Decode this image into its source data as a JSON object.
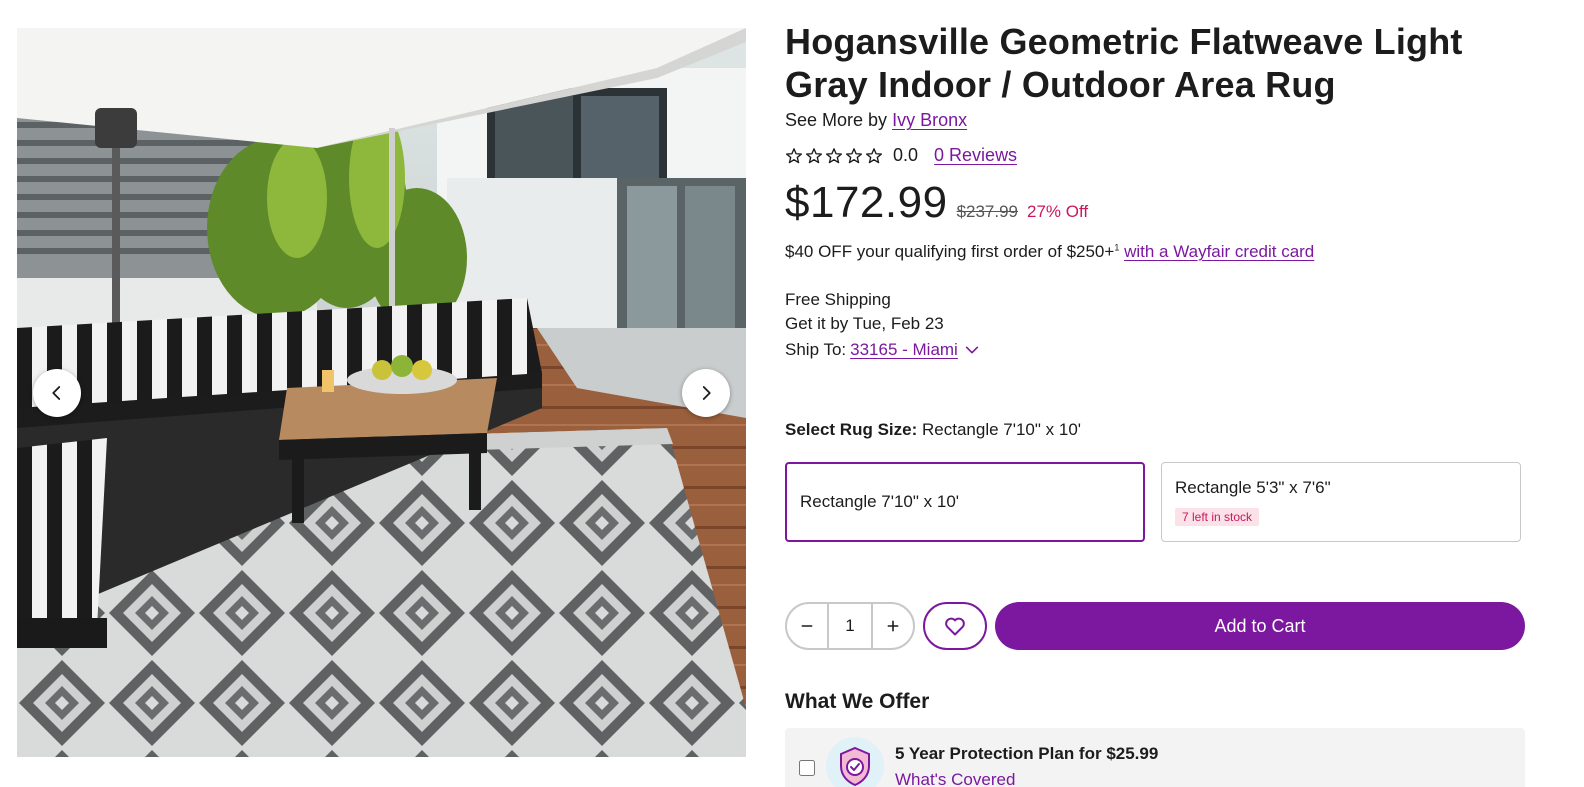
{
  "gallery": {
    "prev_label": "Previous image",
    "next_label": "Next image"
  },
  "product": {
    "title": "Hogansville Geometric Flatweave Light Gray Indoor / Outdoor Area Rug",
    "see_more_prefix": "See More by",
    "brand": "Ivy Bronx",
    "rating_value": "0.0",
    "rating_fraction": 0,
    "stars_total": 5,
    "reviews_link": "0 Reviews",
    "price": "$172.99",
    "original_price": "$237.99",
    "discount": "27% Off"
  },
  "promo": {
    "text": "$40 OFF your qualifying first order of $250+",
    "footnote": "1",
    "link": "with a Wayfair credit card"
  },
  "shipping": {
    "free": "Free Shipping",
    "eta": "Get it by Tue, Feb 23",
    "ship_to_label": "Ship To:",
    "location": "33165 - Miami"
  },
  "size_select": {
    "label": "Select Rug Size:",
    "selected": "Rectangle 7'10\" x 10'",
    "options": [
      {
        "label": "Rectangle 7'10\" x 10'",
        "badge": ""
      },
      {
        "label": "Rectangle 5'3\" x 7'6\"",
        "badge": "7 left in stock"
      }
    ]
  },
  "cart": {
    "quantity": "1",
    "add_label": "Add to Cart"
  },
  "offer": {
    "title": "What We Offer",
    "plan": "5 Year Protection Plan for $25.99",
    "covered_link": "What's Covered"
  },
  "colors": {
    "accent": "#7b189f",
    "sale": "#c7195f"
  },
  "icons": [
    "chevron-left-icon",
    "chevron-right-icon",
    "star-outline-icon",
    "chevron-down-icon",
    "minus-icon",
    "plus-icon",
    "heart-icon",
    "shield-check-icon"
  ]
}
